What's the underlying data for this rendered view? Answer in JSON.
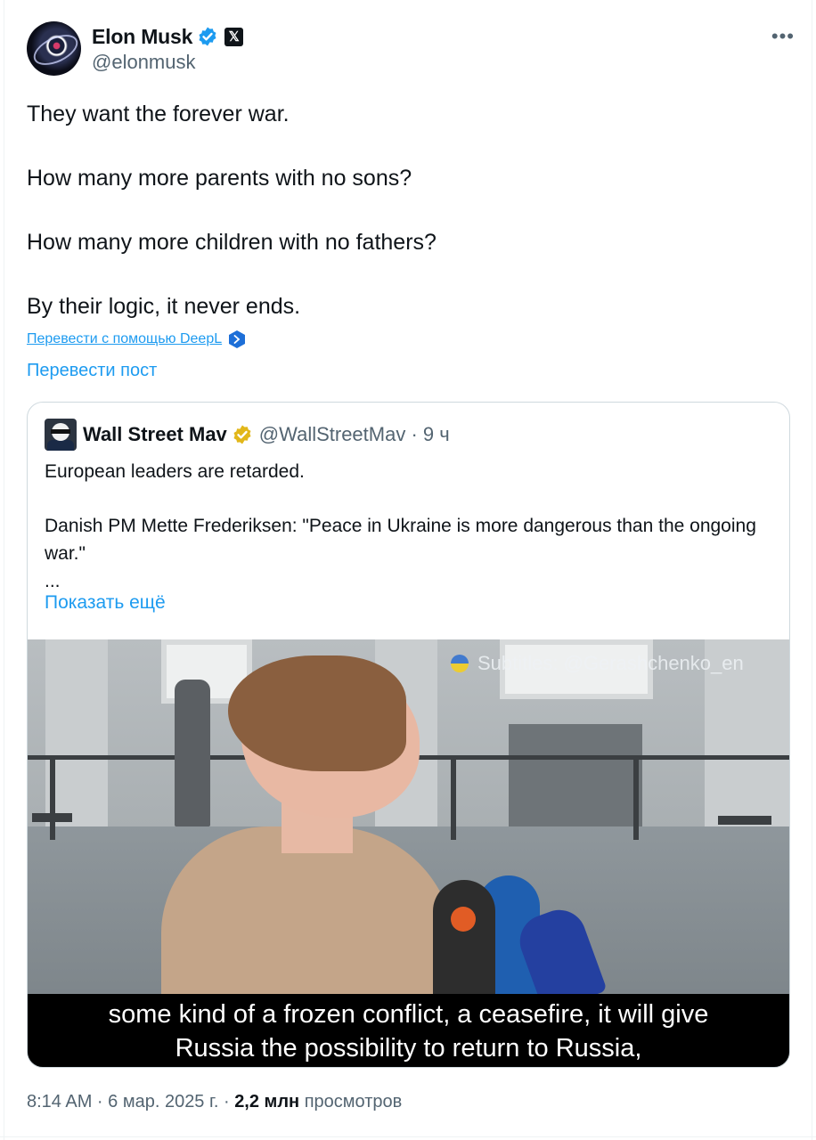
{
  "author": {
    "name": "Elon Musk",
    "handle": "@elonmusk",
    "verified_icon": "verified-badge-icon",
    "affiliate_badge": "𝕏",
    "more_label": "•••"
  },
  "tweet": {
    "paragraphs": [
      "They want the forever war.",
      "How many more parents with no sons?",
      "How many more children with no fathers?",
      "By their logic, it never ends."
    ],
    "deepl_link": "Перевести с помощью DeepL",
    "translate_label": "Перевести пост"
  },
  "quote": {
    "name": "Wall Street Mav",
    "handle_time": "@WallStreetMav · 9 ч",
    "text1": "European leaders are retarded.",
    "text2": "Danish PM Mette Frederiksen:  \"Peace in Ukraine is more dangerous than the ongoing war.\"",
    "ellipsis": "...",
    "show_more": "Показать ещё",
    "video": {
      "watermark": "Subtitles: @Gerashchenko_en",
      "subtitle_line1": "some kind of a frozen conflict, a ceasefire, it will give",
      "subtitle_line2": "Russia the possibility to return to Russia,"
    }
  },
  "meta": {
    "time_date": "8:14 AM · 6 мар. 2025 г. · ",
    "views_count": "2,2 млн",
    "views_label": " просмотров"
  },
  "colors": {
    "accent": "#1d9bf0",
    "text": "#0f1419",
    "muted": "#536471",
    "gold_badge": "#e2b719"
  }
}
